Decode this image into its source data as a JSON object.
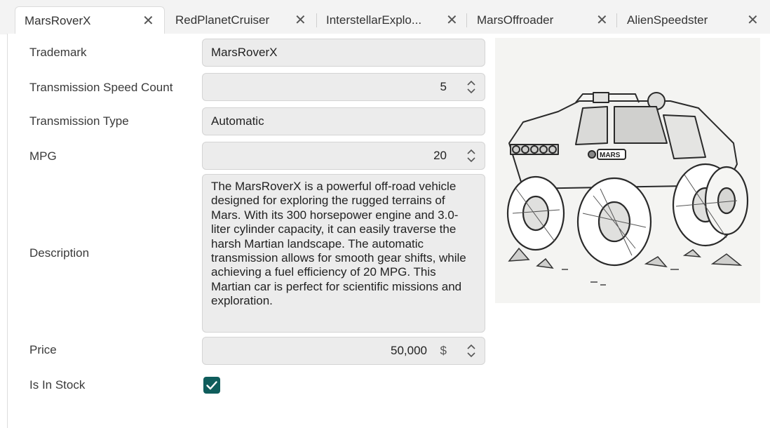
{
  "tabs": [
    {
      "label": "MarsRoverX",
      "active": true
    },
    {
      "label": "RedPlanetCruiser",
      "active": false
    },
    {
      "label": "InterstellarExplo...",
      "active": false
    },
    {
      "label": "MarsOffroader",
      "active": false
    },
    {
      "label": "AlienSpeedster",
      "active": false
    }
  ],
  "close_glyph": "✕",
  "form": {
    "trademark": {
      "label": "Trademark",
      "value": "MarsRoverX"
    },
    "transmission_speed_count": {
      "label": "Transmission Speed Count",
      "value": "5"
    },
    "transmission_type": {
      "label": "Transmission Type",
      "value": "Automatic"
    },
    "mpg": {
      "label": "MPG",
      "value": "20"
    },
    "description": {
      "label": "Description",
      "value": "The MarsRoverX is a powerful off-road vehicle designed for exploring the rugged terrains of Mars. With its 300 horsepower engine and 3.0-liter cylinder capacity, it can easily traverse the harsh Martian landscape. The automatic transmission allows for smooth gear shifts, while achieving a fuel efficiency of 20 MPG. This Martian car is perfect for scientific missions and exploration."
    },
    "price": {
      "label": "Price",
      "value": "50,000",
      "unit": "$"
    },
    "is_in_stock": {
      "label": "Is In Stock",
      "checked": true
    }
  },
  "image": {
    "subject": "Mars rover vehicle sketch",
    "badge_text": "MARS"
  },
  "colors": {
    "accent": "#0f5d5c",
    "field_bg": "#ececec",
    "tabstrip_bg": "#f3f3f3"
  }
}
